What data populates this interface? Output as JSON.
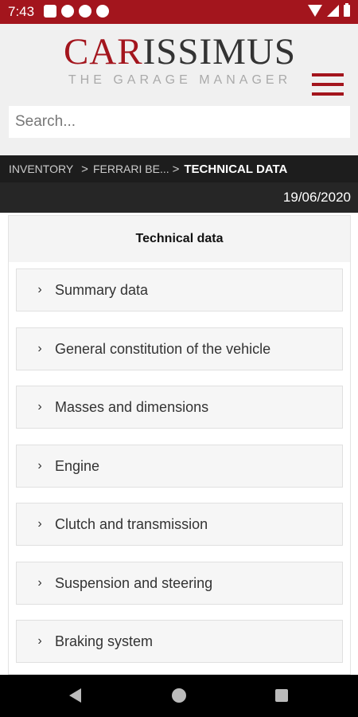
{
  "status_bar": {
    "time": "7:43",
    "background": "#a3151d"
  },
  "header": {
    "logo_part1": "CAR",
    "logo_part2": "ISSIMUS",
    "logo_subtitle": "THE GARAGE MANAGER",
    "accent_color": "#a3151d"
  },
  "search": {
    "placeholder": "Search..."
  },
  "breadcrumb": {
    "items": [
      "INVENTORY",
      "FERRARI BE...",
      "TECHNICAL DATA"
    ]
  },
  "date": "19/06/2020",
  "panel": {
    "title": "Technical data",
    "sections": [
      "Summary data",
      "General constitution of the vehicle",
      "Masses and dimensions",
      "Engine",
      "Clutch and transmission",
      "Suspension and steering",
      "Braking system"
    ]
  },
  "icons": {
    "chevron": "chevron-right-icon",
    "menu": "hamburger-menu-icon"
  }
}
